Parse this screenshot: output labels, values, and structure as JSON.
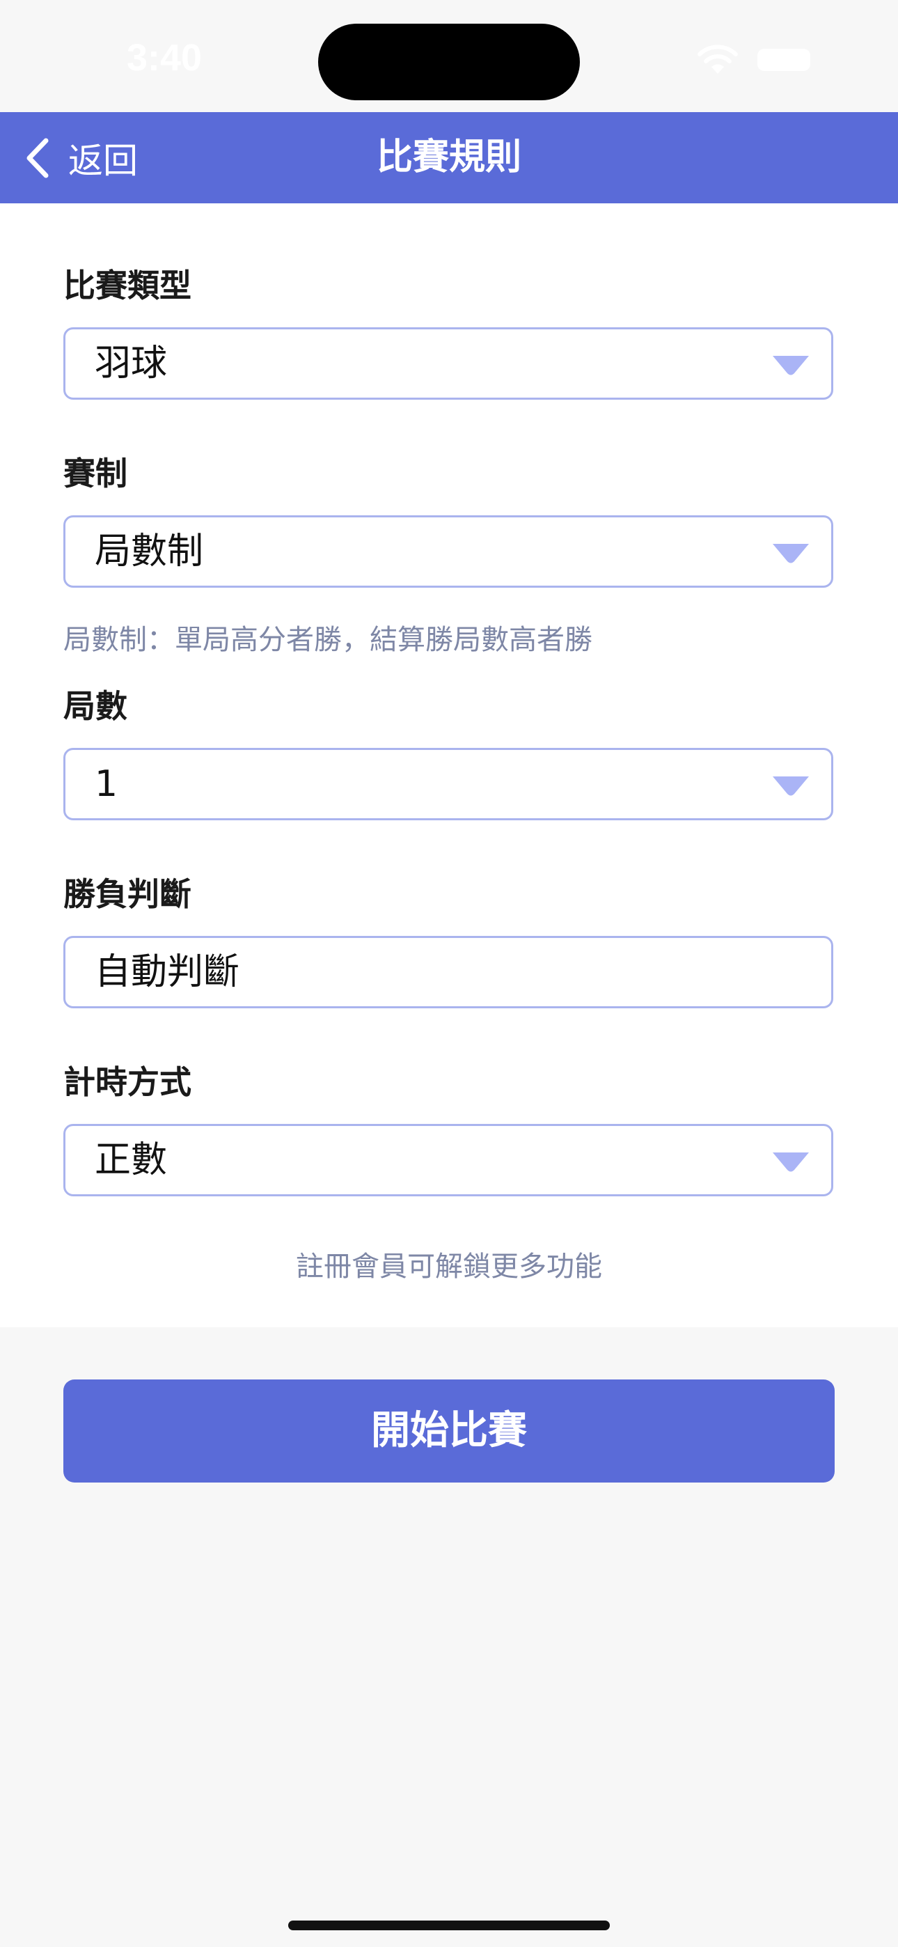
{
  "status_bar": {
    "time": "3:40"
  },
  "nav": {
    "back_label": "返回",
    "title": "比賽規則",
    "color": "#5a6bd8"
  },
  "form": {
    "match_type": {
      "label": "比賽類型",
      "value": "羽球"
    },
    "format": {
      "label": "賽制",
      "value": "局數制",
      "helper": "局數制：單局高分者勝，結算勝局數高者勝"
    },
    "sets": {
      "label": "局數",
      "value": "1"
    },
    "winner_decision": {
      "label": "勝負判斷",
      "value": "自動判斷"
    },
    "timing": {
      "label": "計時方式",
      "value": "正數"
    },
    "member_note": "註冊會員可解鎖更多功能"
  },
  "actions": {
    "start_label": "開始比賽"
  },
  "icons": {
    "back": "chevron-left-icon",
    "dropdown": "chevron-down-icon",
    "wifi": "wifi-icon",
    "battery": "battery-icon"
  }
}
